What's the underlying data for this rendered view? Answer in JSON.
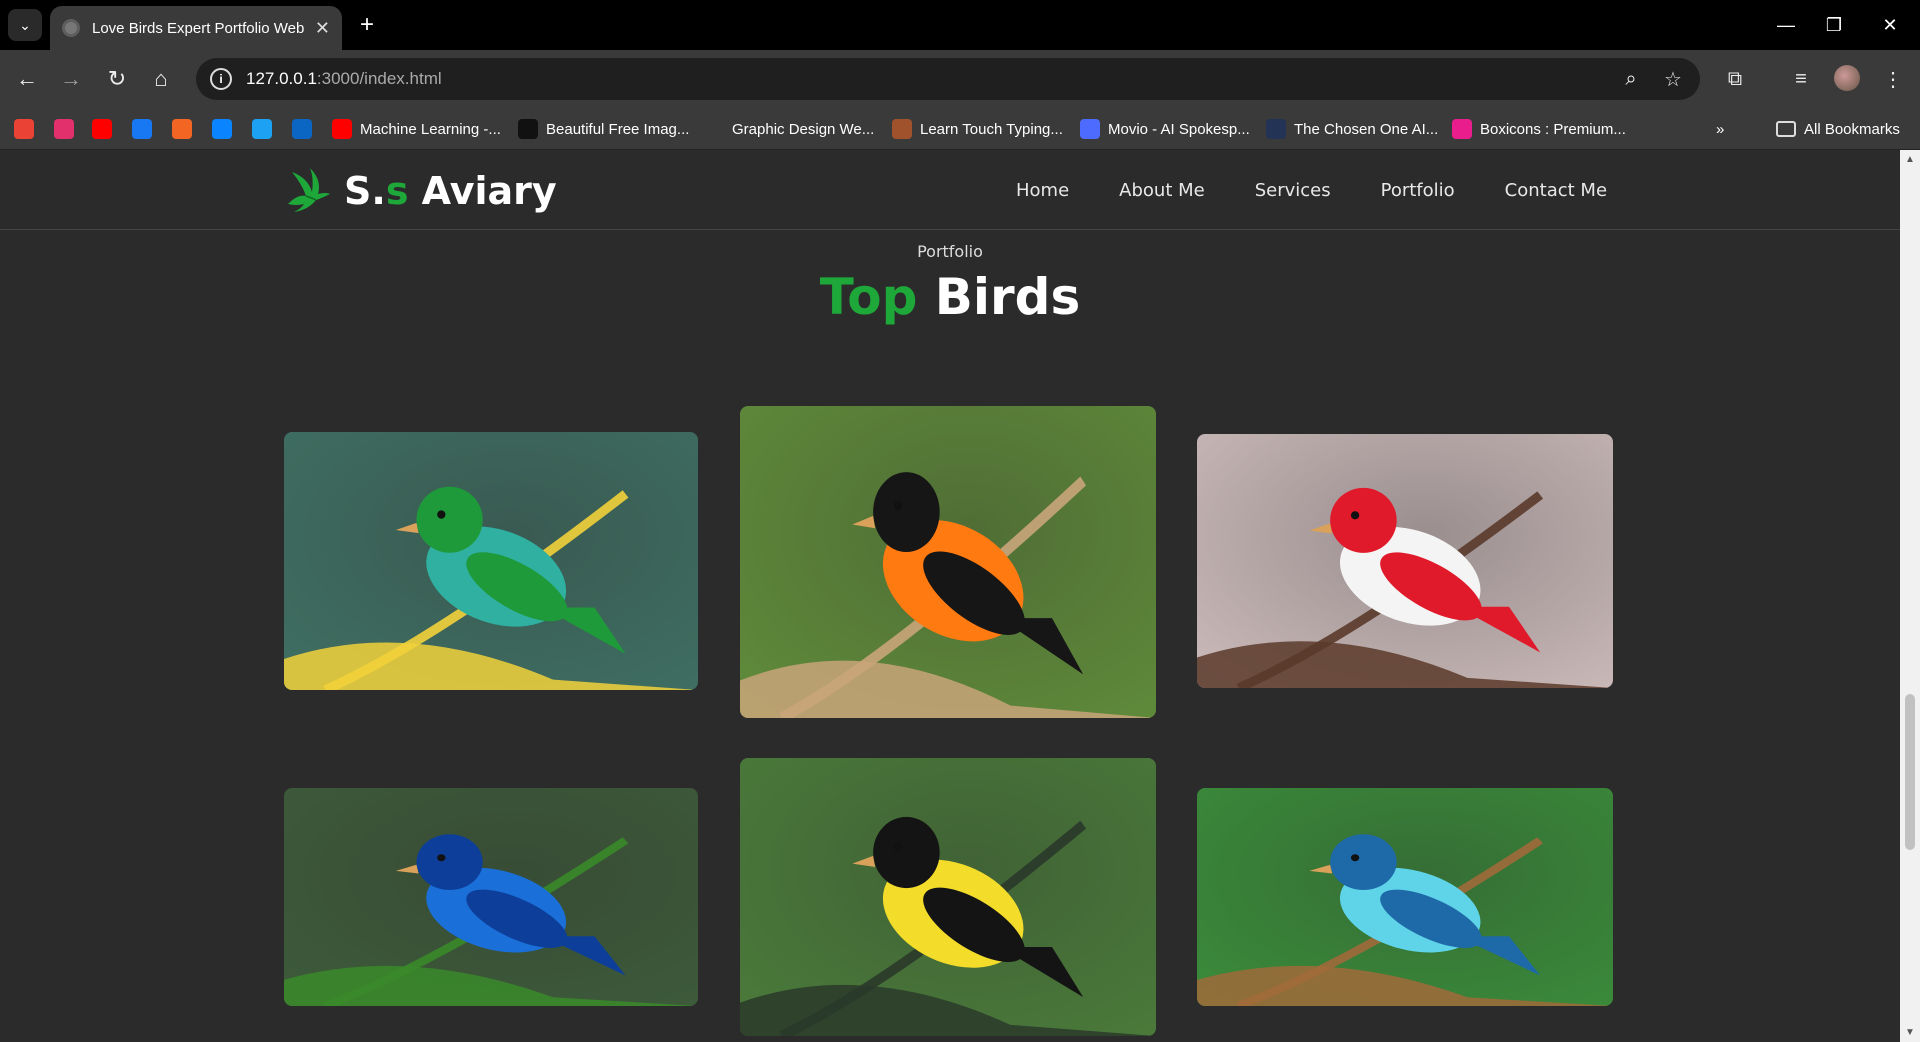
{
  "browser": {
    "tab_title": "Love Birds Expert Portfolio Web",
    "url_host": "127.0.0.1",
    "url_path": ":3000/index.html",
    "bookmarks": [
      {
        "label": "",
        "icon": "gmail-icon",
        "color": "#ea4335"
      },
      {
        "label": "",
        "icon": "instagram-icon",
        "color": "#e1306c"
      },
      {
        "label": "",
        "icon": "youtube-icon",
        "color": "#ff0000"
      },
      {
        "label": "",
        "icon": "facebook-icon",
        "color": "#1877f2"
      },
      {
        "label": "",
        "icon": "app-icon",
        "color": "#f26522"
      },
      {
        "label": "",
        "icon": "cloud-icon",
        "color": "#0a84ff"
      },
      {
        "label": "",
        "icon": "bird-icon",
        "color": "#1da1f2"
      },
      {
        "label": "",
        "icon": "linkedin-icon",
        "color": "#0a66c2"
      },
      {
        "label": "Machine Learning -...",
        "icon": "youtube-icon",
        "color": "#ff0000"
      },
      {
        "label": "Beautiful Free Imag...",
        "icon": "unsplash-icon",
        "color": "#111111"
      },
      {
        "label": "Graphic Design We...",
        "icon": "blank-icon",
        "color": "#3a3a3a"
      },
      {
        "label": "Learn Touch Typing...",
        "icon": "typing-icon",
        "color": "#a0522d"
      },
      {
        "label": "Movio - AI Spokesp...",
        "icon": "movio-icon",
        "color": "#4d6bfe"
      },
      {
        "label": "The Chosen One AI...",
        "icon": "chosen-icon",
        "color": "#223355"
      },
      {
        "label": "Boxicons : Premium...",
        "icon": "boxicons-icon",
        "color": "#e91e8c"
      }
    ],
    "all_bookmarks": "All Bookmarks"
  },
  "site": {
    "logo_prefix": "S.",
    "logo_accent": "s",
    "logo_suffix": " Aviary",
    "nav": [
      "Home",
      "About Me",
      "Services",
      "Portfolio",
      "Contact Me"
    ],
    "eyebrow": "Portfolio",
    "heading_accent": "Top",
    "heading_rest": " Birds",
    "accent_color": "#1fa83a"
  },
  "gallery": [
    {
      "alt": "Seven-colored tanager",
      "palette": [
        "#3f6e62",
        "#2fb0a0",
        "#1e9a3a",
        "#f2d23a"
      ]
    },
    {
      "alt": "Baltimore oriole",
      "palette": [
        "#5f8a3a",
        "#ff7a10",
        "#161616",
        "#c9a57a"
      ]
    },
    {
      "alt": "Red and white cardinal",
      "palette": [
        "#c9b8b8",
        "#f4f4f4",
        "#e01a2a",
        "#5a3a2a"
      ]
    },
    {
      "alt": "Indigo bunting",
      "palette": [
        "#3d5a3a",
        "#1a6fd8",
        "#0d3f9a",
        "#3a8a2a"
      ]
    },
    {
      "alt": "American goldfinch",
      "palette": [
        "#4a7a3a",
        "#f3dd2a",
        "#141414",
        "#2a3a2a"
      ]
    },
    {
      "alt": "Blue budgerigar",
      "palette": [
        "#3a8a3a",
        "#5fd4e8",
        "#1e6aa8",
        "#a06a3a"
      ]
    }
  ]
}
